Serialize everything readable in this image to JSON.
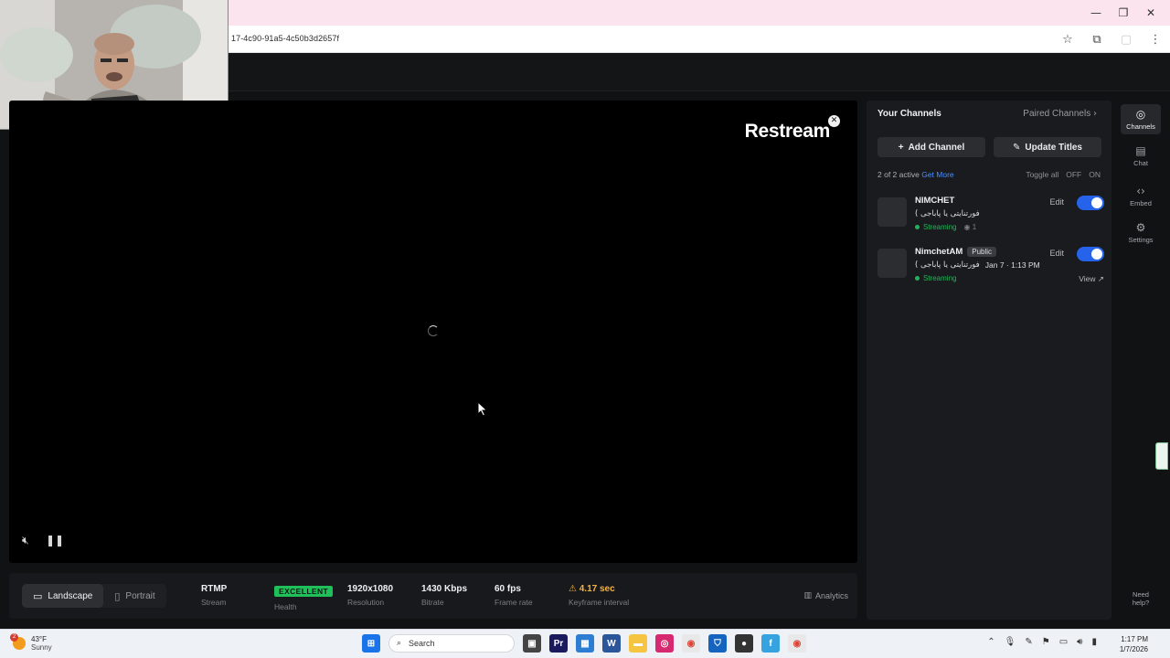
{
  "browser": {
    "url": "17-4c90-91a5-4c50b3d2657f",
    "window_controls": [
      "—",
      "❐",
      "✕"
    ]
  },
  "video": {
    "brand": "Restream"
  },
  "stats": {
    "orientation": {
      "landscape": "Landscape",
      "portrait": "Portrait",
      "selected": "Landscape"
    },
    "protocol": {
      "value": "RTMP",
      "label": "Stream"
    },
    "health": {
      "value": "EXCELLENT",
      "label": "Health"
    },
    "resolution": {
      "value": "1920x1080",
      "label": "Resolution"
    },
    "bitrate": {
      "value": "1430 Kbps",
      "label": "Bitrate"
    },
    "framerate": {
      "value": "60 fps",
      "label": "Frame rate"
    },
    "keyframe": {
      "value": "4.17 sec",
      "label": "Keyframe interval"
    },
    "analytics_label": "Analytics"
  },
  "panel": {
    "title": "Your Channels",
    "paired_label": "Paired Channels",
    "add_channel": "Add Channel",
    "update_titles": "Update Titles",
    "active_count": "2 of 2 active",
    "get_more": "Get More",
    "toggle_all": "Toggle all",
    "off": "OFF",
    "on": "ON",
    "channels": [
      {
        "name": "NIMCHET",
        "badge": "",
        "title": "( فورتنایتی یا پاباجی",
        "date": "",
        "status": "Streaming",
        "viewers": "1",
        "edit": "Edit",
        "enabled": true,
        "view": ""
      },
      {
        "name": "NimchetAM",
        "badge": "Public",
        "title": "( فورتنایتی یا پاباجی",
        "date": "Jan 7 · 1:13 PM",
        "status": "Streaming",
        "viewers": "",
        "edit": "Edit",
        "enabled": true,
        "view": "View"
      }
    ]
  },
  "rail": {
    "items": [
      {
        "label": "Channels",
        "icon": "broadcast-icon"
      },
      {
        "label": "Chat",
        "icon": "chat-icon"
      },
      {
        "label": "Embed",
        "icon": "code-icon"
      },
      {
        "label": "Settings",
        "icon": "gear-icon"
      }
    ],
    "need_help": "Need help?"
  },
  "taskbar": {
    "temp": "43°F",
    "weather": "Sunny",
    "weather_badge": "2",
    "search": "Search",
    "time": "1:17 PM",
    "date": "1/7/2026"
  },
  "colors": {
    "accent_blue": "#2563eb",
    "healthy_green": "#1fbf5a",
    "warning": "#f5b342",
    "link": "#4a8dff"
  }
}
